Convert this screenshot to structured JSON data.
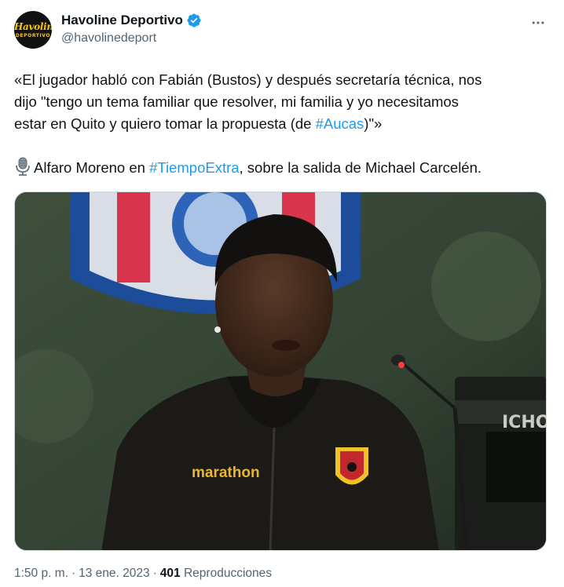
{
  "account": {
    "display_name": "Havoline Deportivo",
    "handle": "@havolinedeport",
    "avatar_text_top": "Havoline",
    "avatar_text_bottom": "DEPORTIVO",
    "verified_color": "#1d9bf0"
  },
  "tweet": {
    "line1": "«El jugador habló con Fabián (Bustos) y después secretaría técnica, nos",
    "line2": "dijo \"tengo un tema familiar que resolver, mi familia y yo necesitamos",
    "line3_before": "estar en Quito y quiero tomar la propuesta (de ",
    "line3_hashtag": "#Aucas",
    "line3_after": ")\"»",
    "line4_before": "Alfaro Moreno en ",
    "line4_hashtag": "#TiempoExtra",
    "line4_after": ", sobre la salida de Michael Carcelén.",
    "hashtag_color": "#1d9bf0"
  },
  "media": {
    "jacket_brand": "marathon",
    "bg_visible_text": "ICHON"
  },
  "footer": {
    "time": "1:50 p. m.",
    "separator": "·",
    "date": "13 ene. 2023",
    "views_count": "401",
    "views_label": "Reproducciones"
  },
  "icons": {
    "more": "more-horizontal-icon",
    "verified": "verified-badge-icon",
    "mic": "microphone-icon"
  }
}
